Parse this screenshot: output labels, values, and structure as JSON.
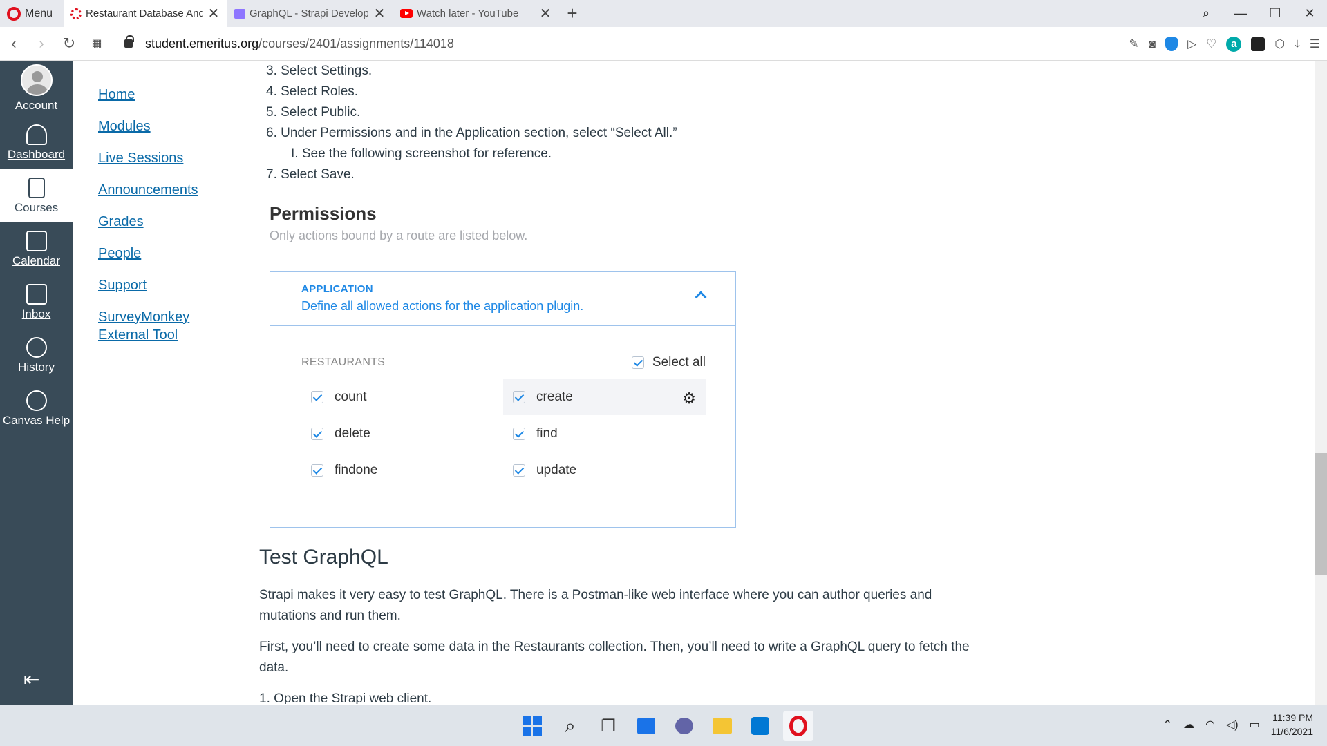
{
  "browser": {
    "menu_label": "Menu",
    "tabs": [
      {
        "title": "Restaurant Database And GraphQL"
      },
      {
        "title": "GraphQL - Strapi Developer Docs"
      },
      {
        "title": "Watch later - YouTube"
      }
    ],
    "url_host": "student.emeritus.org",
    "url_path": "/courses/2401/assignments/114018"
  },
  "global_nav": {
    "items": [
      {
        "label": "Account",
        "icon": "avatar"
      },
      {
        "label": "Dashboard",
        "icon": "dashboard-icon"
      },
      {
        "label": "Courses",
        "icon": "courses-icon"
      },
      {
        "label": "Calendar",
        "icon": "calendar-icon"
      },
      {
        "label": "Inbox",
        "icon": "inbox-icon"
      },
      {
        "label": "History",
        "icon": "clock-icon"
      },
      {
        "label": "Canvas Help",
        "icon": "help-icon"
      }
    ]
  },
  "course_nav": {
    "items": [
      {
        "label": "Home"
      },
      {
        "label": "Modules"
      },
      {
        "label": "Live Sessions"
      },
      {
        "label": "Announcements"
      },
      {
        "label": "Grades"
      },
      {
        "label": "People"
      },
      {
        "label": "Support"
      },
      {
        "label": "SurveyMonkey External Tool"
      }
    ]
  },
  "content": {
    "steps": [
      "3. Select Settings.",
      "4. Select Roles.",
      "5. Select Public.",
      "6. Under Permissions and in the Application section, select “Select All.”"
    ],
    "substep": "I. See the following screenshot for reference.",
    "step7": "7. Select Save.",
    "permissions": {
      "title": "Permissions",
      "subtitle": "Only actions bound by a route are listed below.",
      "section_title": "APPLICATION",
      "section_desc": "Define all allowed actions for the application plugin.",
      "group": "RESTAURANTS",
      "select_all": "Select all",
      "actions": [
        "count",
        "create",
        "delete",
        "find",
        "findone",
        "update"
      ]
    },
    "heading": "Test GraphQL",
    "para1": "Strapi makes it very easy to test GraphQL. There is a Postman-like web interface where you can author queries and mutations and run them.",
    "para2": "First, you’ll need to create some data in the Restaurants collection. Then, you’ll need to write a GraphQL query to fetch the data.",
    "step_next": "1. Open the Strapi web client."
  },
  "taskbar": {
    "time": "11:39 PM",
    "date": "11/6/2021"
  },
  "colors": {
    "nav_bg": "#394b58",
    "link": "#0a6aa8",
    "accent": "#1e88e5"
  }
}
